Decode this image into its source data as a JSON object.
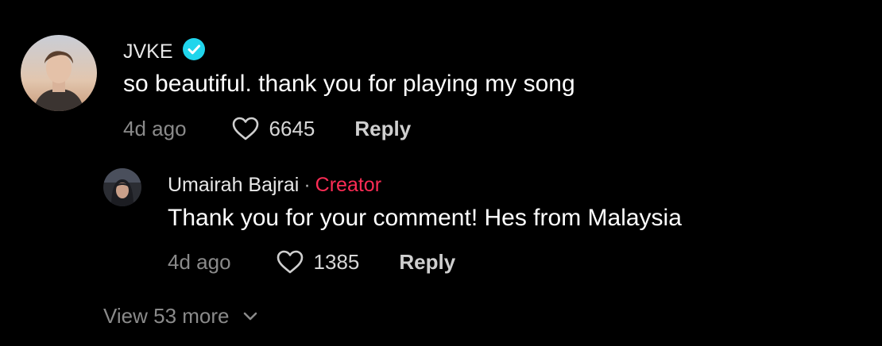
{
  "colors": {
    "background": "#000000",
    "verified_badge": "#20D5EC",
    "creator_accent": "#FE2C55",
    "muted_text": "#8A8A8A"
  },
  "comments": [
    {
      "username": "JVKE",
      "verified": true,
      "avatar_icon": "avatar-jvke",
      "text": "so beautiful. thank you for playing my song",
      "timestamp": "4d ago",
      "likes": "6645",
      "reply_label": "Reply"
    }
  ],
  "replies": [
    {
      "username": "Umairah Bajrai",
      "separator": "·",
      "badge": "Creator",
      "avatar_icon": "avatar-umairah",
      "text": "Thank you for your comment! Hes from Malaysia",
      "timestamp": "4d ago",
      "likes": "1385",
      "reply_label": "Reply"
    }
  ],
  "view_more": {
    "label": "View 53 more",
    "icon": "chevron-down-icon"
  }
}
